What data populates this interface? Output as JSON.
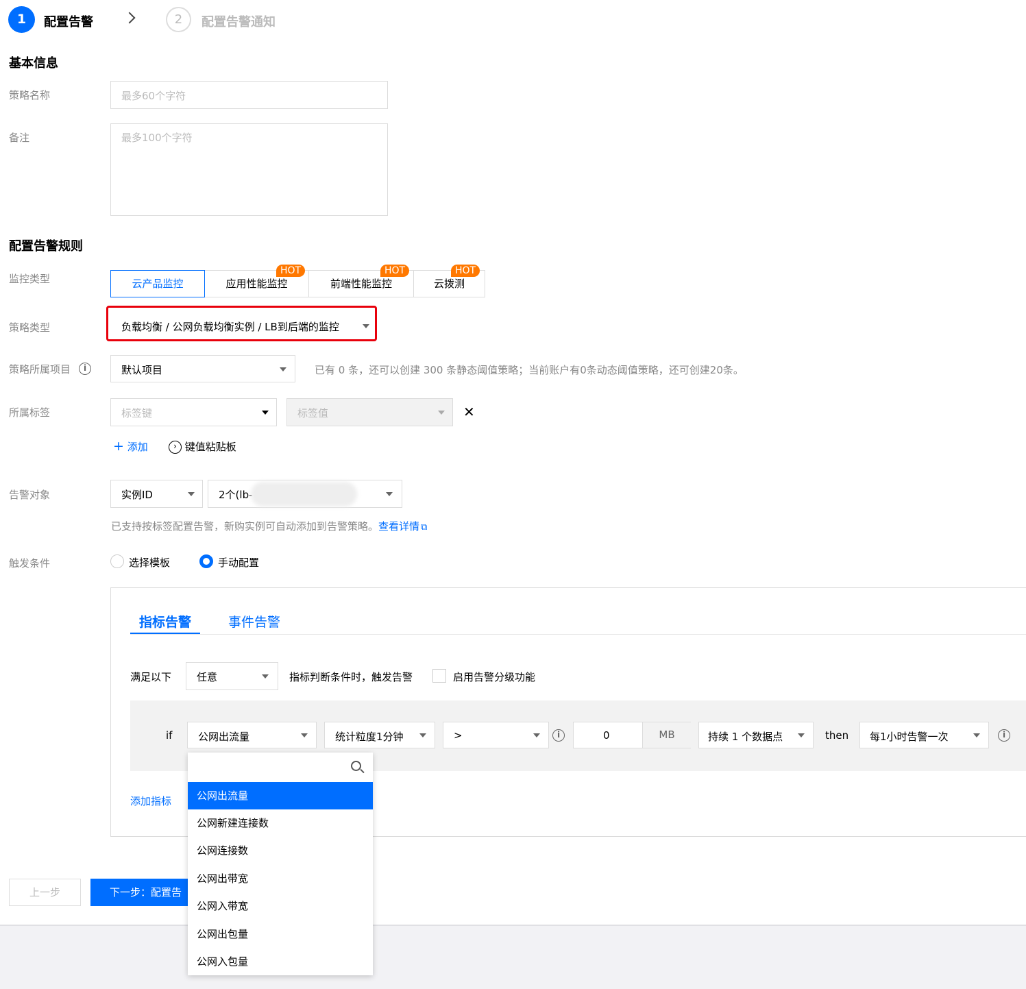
{
  "steps": [
    {
      "num": "1",
      "label": "配置告警"
    },
    {
      "num": "2",
      "label": "配置告警通知"
    }
  ],
  "basic": {
    "title": "基本信息",
    "name_label": "策略名称",
    "name_placeholder": "最多60个字符",
    "remark_label": "备注",
    "remark_placeholder": "最多100个字符"
  },
  "rules": {
    "title": "配置告警规则",
    "monitor_label": "监控类型",
    "monitor_tabs": [
      {
        "label": "云产品监控",
        "hot": ""
      },
      {
        "label": "应用性能监控",
        "hot": "HOT"
      },
      {
        "label": "前端性能监控",
        "hot": "HOT"
      },
      {
        "label": "云拨测",
        "hot": "HOT"
      }
    ],
    "policy_type_label": "策略类型",
    "policy_type_value": "负载均衡 / 公网负载均衡实例 / LB到后端的监控",
    "project_label": "策略所属项目",
    "project_value": "默认项目",
    "project_hint": "已有 0 条，还可以创建 300 条静态阈值策略；当前账户有0条动态阈值策略，还可创建20条。",
    "tag_label": "所属标签",
    "tag_key_placeholder": "标签键",
    "tag_value_placeholder": "标签值",
    "add_label": "添加",
    "paste_label": "键值粘贴板",
    "target_label": "告警对象",
    "target_type": "实例ID",
    "target_value": "2个(lb-",
    "target_hint": "已支持按标签配置告警，新购实例可自动添加到告警策略。",
    "target_link": "查看详情",
    "trigger_label": "触发条件",
    "trigger_opt1": "选择模板",
    "trigger_opt2": "手动配置"
  },
  "panel": {
    "tab_metric": "指标告警",
    "tab_event": "事件告警",
    "satisfy_label": "满足以下",
    "satisfy_value": "任意",
    "satisfy_suffix": "指标判断条件时，触发告警",
    "grading_label": "启用告警分级功能",
    "if_label": "if",
    "metric_value": "公网出流量",
    "period_value": "统计粒度1分钟",
    "operator_value": ">",
    "threshold_value": "0",
    "unit": "MB",
    "duration_value": "持续 1 个数据点",
    "then_label": "then",
    "frequency_value": "每1小时告警一次",
    "add_metric": "添加指标"
  },
  "dropdown": {
    "items": [
      "公网出流量",
      "公网新建连接数",
      "公网连接数",
      "公网出带宽",
      "公网入带宽",
      "公网出包量",
      "公网入包量"
    ],
    "selected": 0
  },
  "footer": {
    "prev": "上一步",
    "next": "下一步：配置告"
  },
  "colors": {
    "accent": "#006eff",
    "hot": "#ff7800",
    "highlight_box": "#e8000b"
  }
}
